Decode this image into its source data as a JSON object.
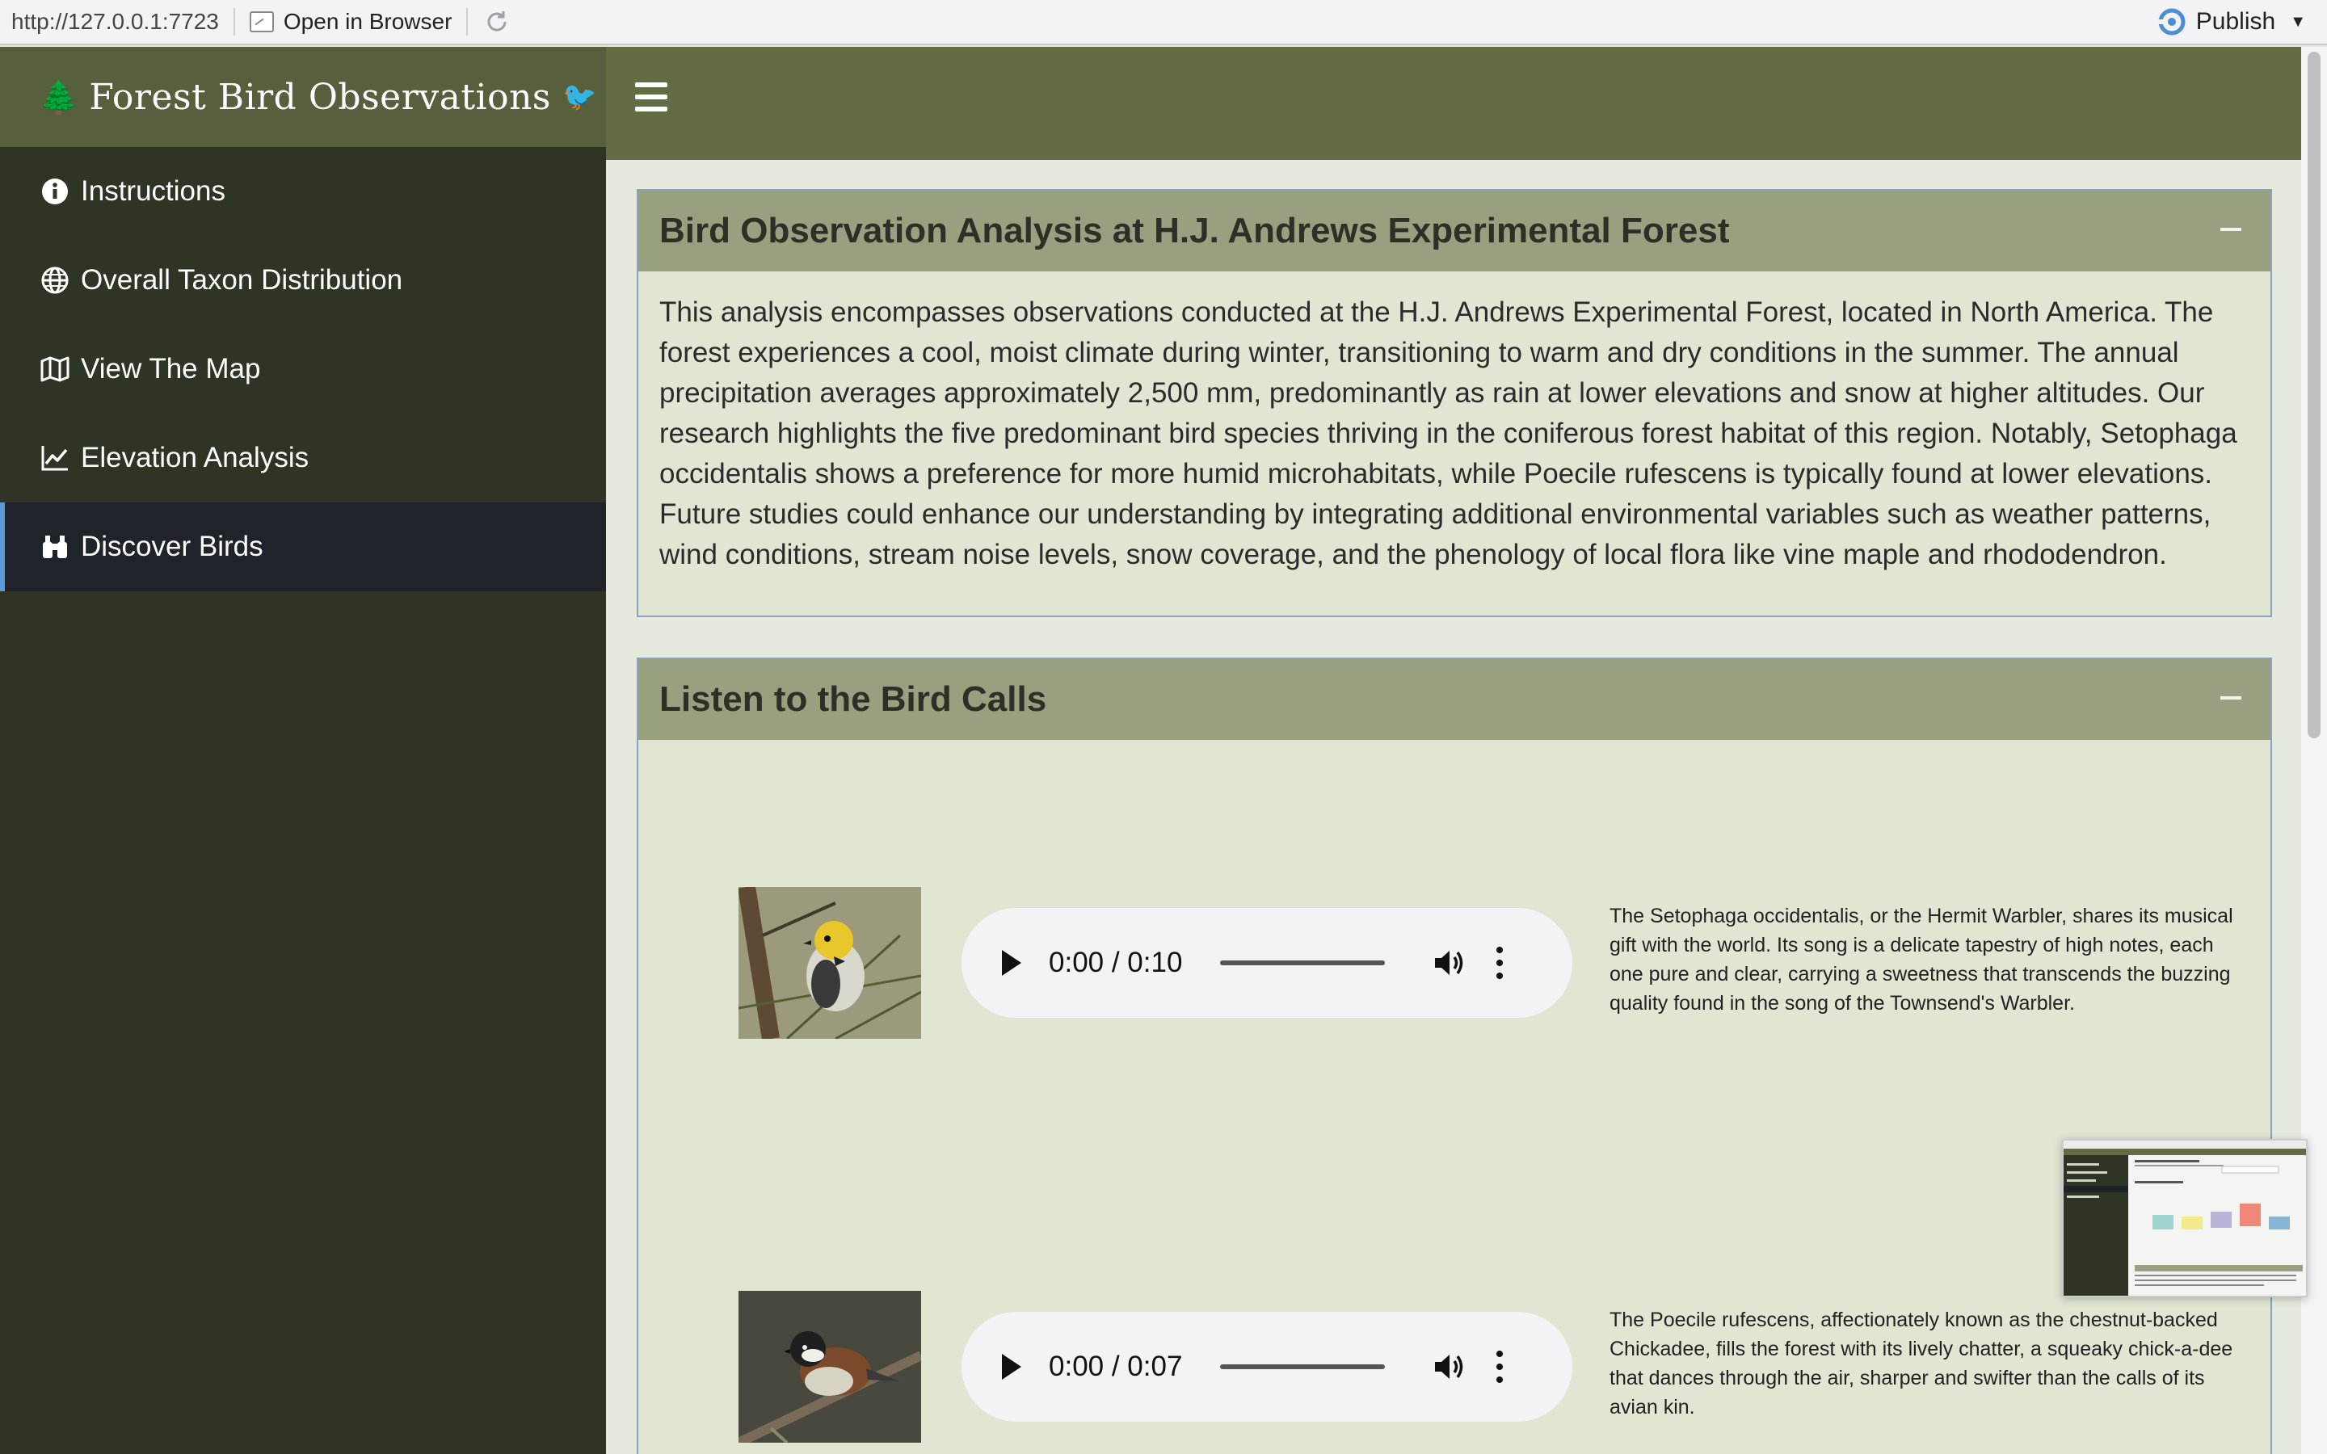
{
  "viewer": {
    "url": "http://127.0.0.1:7723",
    "open_in_browser": "Open in Browser",
    "publish": "Publish"
  },
  "app": {
    "title": "Forest Bird Observations"
  },
  "sidebar": {
    "items": [
      {
        "label": "Instructions",
        "icon": "info-circle-icon"
      },
      {
        "label": "Overall Taxon Distribution",
        "icon": "globe-icon"
      },
      {
        "label": "View The Map",
        "icon": "map-icon"
      },
      {
        "label": "Elevation Analysis",
        "icon": "line-chart-icon"
      },
      {
        "label": "Discover Birds",
        "icon": "binoculars-icon",
        "active": true
      }
    ]
  },
  "analysis_box": {
    "title": "Bird Observation Analysis at H.J. Andrews Experimental Forest",
    "body": "This analysis encompasses observations conducted at the H.J. Andrews Experimental Forest, located in North America. The forest experiences a cool, moist climate during winter, transitioning to warm and dry conditions in the summer. The annual precipitation averages approximately 2,500 mm, predominantly as rain at lower elevations and snow at higher altitudes. Our research highlights the five predominant bird species thriving in the coniferous forest habitat of this region. Notably, Setophaga occidentalis shows a preference for more humid microhabitats, while Poecile rufescens is typically found at lower elevations. Future studies could enhance our understanding by integrating additional environmental variables such as weather patterns, wind conditions, stream noise levels, snow coverage, and the phenology of local flora like vine maple and rhododendron."
  },
  "calls_box": {
    "title": "Listen to the Bird Calls",
    "birds": [
      {
        "time": "0:00 / 0:10",
        "description": "The Setophaga occidentalis, or the Hermit Warbler, shares its musical gift with the world. Its song is a delicate tapestry of high notes, each one pure and clear, carrying a sweetness that transcends the buzzing quality found in the song of the Townsend's Warbler."
      },
      {
        "time": "0:00 / 0:07",
        "description": "The Poecile rufescens, affectionately known as the chestnut-backed Chickadee, fills the forest with its lively chatter, a squeaky chick-a-dee that dances through the air, sharper and swifter than the calls of its avian kin."
      }
    ]
  },
  "colors": {
    "header": "#636d44",
    "sidebar": "#2f3524",
    "box_header": "#97a07f",
    "box_body": "#e1e6d3",
    "active_accent": "#5c9bd6"
  }
}
